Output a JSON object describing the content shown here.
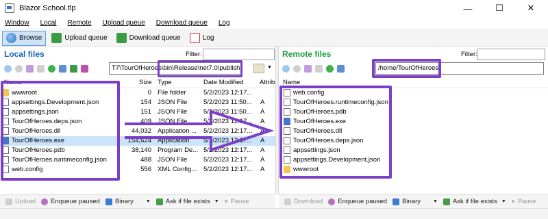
{
  "window": {
    "title": "Blazor School.tlp",
    "controls": {
      "minimize": "—",
      "maximize": "☐",
      "close": "✕"
    }
  },
  "menu": [
    "Window",
    "Local",
    "Remote",
    "Upload queue",
    "Download queue",
    "Log"
  ],
  "toolbar": {
    "browse": "Browse",
    "upload_queue": "Upload queue",
    "download_queue": "Download queue",
    "log": "Log"
  },
  "local": {
    "title": "Local files",
    "filter_label": "Filter:",
    "path": "T7\\TourOfHeroes\\bin\\Release\\net7.0\\publish",
    "columns": [
      "Name",
      "Size",
      "Type",
      "Date Modified",
      "Attribu"
    ],
    "files": [
      {
        "name": "wwwroot",
        "size": "0",
        "type": "File folder",
        "date": "5/2/2023 12:17...",
        "attr": "",
        "icon": "folder-icon"
      },
      {
        "name": "appsettings.Development.json",
        "size": "154",
        "type": "JSON File",
        "date": "5/2/2023 11:50...",
        "attr": "A",
        "icon": "json-file-icon"
      },
      {
        "name": "appsettings.json",
        "size": "151",
        "type": "JSON File",
        "date": "5/2/2023 11:50...",
        "attr": "A",
        "icon": "json-file-icon"
      },
      {
        "name": "TourOfHeroes.deps.json",
        "size": "409",
        "type": "JSON File",
        "date": "5/2/2023 12:17...",
        "attr": "A",
        "icon": "json-file-icon"
      },
      {
        "name": "TourOfHeroes.dll",
        "size": "44,032",
        "type": "Application ...",
        "date": "5/2/2023 12:17...",
        "attr": "A",
        "icon": "dll-file-icon"
      },
      {
        "name": "TourOfHeroes.exe",
        "size": "154,624",
        "type": "Application",
        "date": "5/2/2023 12:17...",
        "attr": "A",
        "icon": "exe-file-icon"
      },
      {
        "name": "TourOfHeroes.pdb",
        "size": "38,140",
        "type": "Program De...",
        "date": "5/2/2023 12:17...",
        "attr": "A",
        "icon": "pdb-file-icon"
      },
      {
        "name": "TourOfHeroes.runtimeconfig.json",
        "size": "488",
        "type": "JSON File",
        "date": "5/2/2023 12:17...",
        "attr": "A",
        "icon": "json-file-icon"
      },
      {
        "name": "web.config",
        "size": "556",
        "type": "XML Config...",
        "date": "5/2/2023 12:17...",
        "attr": "A",
        "icon": "config-file-icon"
      }
    ]
  },
  "remote": {
    "title": "Remote files",
    "filter_label": "Filter:",
    "path": "/home/TourOfHeroes",
    "columns": [
      "Name"
    ],
    "files": [
      {
        "name": "web.config",
        "icon": "config-file-icon"
      },
      {
        "name": "TourOfHeroes.runtimeconfig.json",
        "icon": "json-file-icon"
      },
      {
        "name": "TourOfHeroes.pdb",
        "icon": "pdb-file-icon"
      },
      {
        "name": "TourOfHeroes.exe",
        "icon": "exe-file-icon"
      },
      {
        "name": "TourOfHeroes.dll",
        "icon": "dll-file-icon"
      },
      {
        "name": "TourOfHeroes.deps.json",
        "icon": "json-file-icon"
      },
      {
        "name": "appsettings.json",
        "icon": "json-file-icon"
      },
      {
        "name": "appsettings.Development.json",
        "icon": "json-file-icon"
      },
      {
        "name": "wwwroot",
        "icon": "folder-icon"
      }
    ]
  },
  "status_local": {
    "upload": "Upload",
    "enqueue": "Enqueue paused",
    "binary": "Binary",
    "ask": "Ask if file exists",
    "pause": "Pause"
  },
  "status_remote": {
    "download": "Download",
    "enqueue": "Enqueue paused",
    "binary": "Binary",
    "ask": "Ask if file exists",
    "pause": "Pause"
  },
  "colors": {
    "accent": "#1565c0",
    "remote_title": "#1e9e3a",
    "highlight": "#7b3fc7",
    "selection": "#cce4fb"
  }
}
